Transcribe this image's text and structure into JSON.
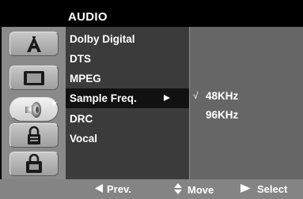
{
  "title": "AUDIO",
  "categories": [
    {
      "name": "language-icon",
      "active": false
    },
    {
      "name": "display-icon",
      "active": false
    },
    {
      "name": "speaker-icon",
      "active": true
    },
    {
      "name": "lock-icon",
      "active": false
    },
    {
      "name": "others-icon",
      "active": false
    }
  ],
  "menu": {
    "items": [
      {
        "label": "Dolby Digital"
      },
      {
        "label": "DTS"
      },
      {
        "label": "MPEG"
      },
      {
        "label": "Sample Freq."
      },
      {
        "label": "DRC"
      },
      {
        "label": "Vocal"
      }
    ],
    "selected_index": 3
  },
  "options": {
    "items": [
      {
        "label": "48KHz",
        "checked": true,
        "check_mark": "√"
      },
      {
        "label": "96KHz",
        "checked": false,
        "check_mark": ""
      }
    ]
  },
  "footer": {
    "prev": "Prev.",
    "move": "Move",
    "select": "Select"
  },
  "colors": {
    "background": "#000000",
    "frame": "#8a8a8a",
    "menu_panel": "#3b3b3b",
    "menu_selected": "#111111",
    "options_panel": "#666666",
    "bottom_bar": "#848484",
    "text": "#ffffff"
  }
}
